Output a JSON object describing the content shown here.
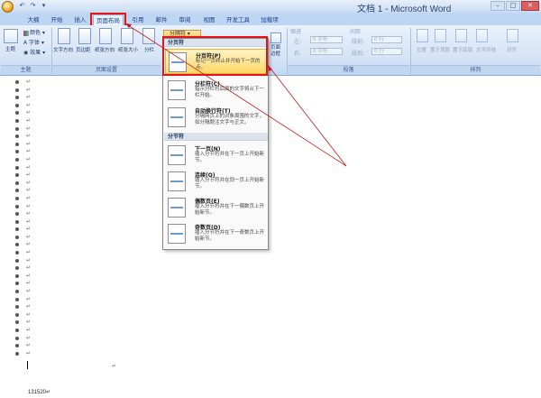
{
  "window": {
    "title": "文档 1 - Microsoft Word"
  },
  "tabs": [
    {
      "label": "大纲"
    },
    {
      "label": "开始"
    },
    {
      "label": "插入"
    },
    {
      "label": "页面布局"
    },
    {
      "label": "引用"
    },
    {
      "label": "邮件"
    },
    {
      "label": "审阅"
    },
    {
      "label": "视图"
    },
    {
      "label": "开发工具"
    },
    {
      "label": "加载项"
    }
  ],
  "ribbon": {
    "theme": {
      "big_label": "主题",
      "colors": "颜色",
      "fonts": "字体",
      "effects": "效果",
      "caption": "主题"
    },
    "page_setup": {
      "buttons": [
        "文字方向",
        "页边距",
        "纸张方向",
        "纸张大小",
        "分栏"
      ],
      "breaks_button": "分隔符",
      "caption": "页面设置"
    },
    "page_bg": {
      "border_label": "页面边框"
    },
    "paragraph": {
      "indent_label": "缩进",
      "spacing_label": "间距",
      "left": "左:",
      "right": "右:",
      "left_value": "0 字符",
      "right_value": "0 字符",
      "before": "段前:",
      "after": "段后:",
      "before_value": "0 行",
      "after_value": "0 行",
      "caption": "段落"
    },
    "arrange": {
      "buttons": [
        "位置",
        "置于顶层",
        "置于底层",
        "文字环绕",
        "对齐"
      ],
      "caption": "排列"
    }
  },
  "dropdown": {
    "page_breaks_header": "分页符",
    "section_breaks_header": "分节符",
    "items": [
      {
        "title": "分页符(P)",
        "desc": "标记一页终止并开始下一页的点。"
      },
      {
        "title": "分栏符(C)",
        "desc": "指示分栏符后面的文字将从下一栏开始。"
      },
      {
        "title": "自动换行符(T)",
        "desc": "分隔网页上的对象周围的文字，如分隔题注文字与正文。"
      },
      {
        "title": "下一页(N)",
        "desc": "插入分节符并在下一页上开始新节。"
      },
      {
        "title": "连续(O)",
        "desc": "插入分节符并在同一页上开始新节。"
      },
      {
        "title": "偶数页(E)",
        "desc": "插入分节符并在下一偶数页上开始新节。"
      },
      {
        "title": "奇数页(D)",
        "desc": "插入分节符并在下一奇数页上开始新节。"
      }
    ]
  },
  "document": {
    "paragraph_mark": "↵",
    "footer_number": "131520↵"
  },
  "colors": {
    "annotation": "#e4141a",
    "ribbon_bg": "#d4e3f6",
    "hover": "#ffd766"
  }
}
